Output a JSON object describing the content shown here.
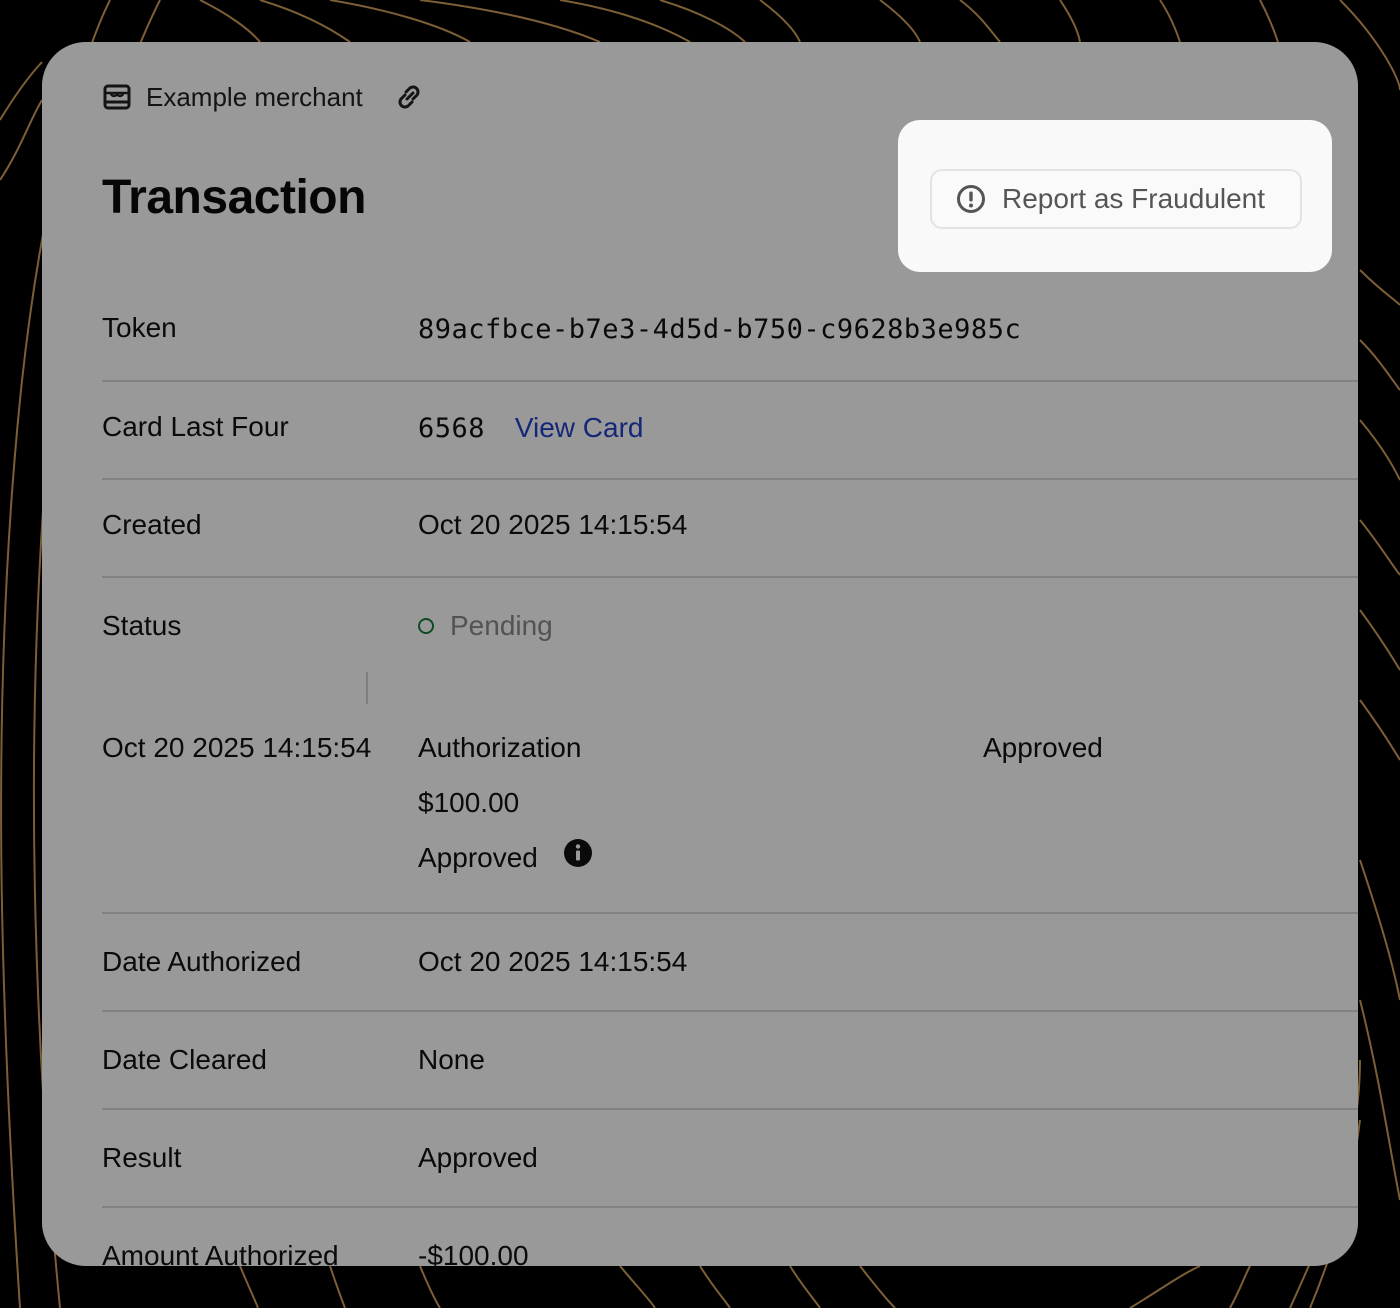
{
  "merchant": {
    "name": "Example merchant"
  },
  "page": {
    "title": "Transaction"
  },
  "actions": {
    "report_fraud_label": "Report as Fraudulent"
  },
  "fields": {
    "token": {
      "label": "Token",
      "value": "89acfbce-b7e3-4d5d-b750-c9628b3e985c"
    },
    "card_last_four": {
      "label": "Card Last Four",
      "value": "6568",
      "link_label": "View Card"
    },
    "created": {
      "label": "Created",
      "value": "Oct 20 2025 14:15:54"
    },
    "status": {
      "label": "Status",
      "value": "Pending"
    },
    "date_authorized": {
      "label": "Date Authorized",
      "value": "Oct 20 2025 14:15:54"
    },
    "date_cleared": {
      "label": "Date Cleared",
      "value": "None"
    },
    "result": {
      "label": "Result",
      "value": "Approved"
    },
    "amount_authorized": {
      "label": "Amount Authorized",
      "value": "-$100.00"
    }
  },
  "timeline": {
    "events": [
      {
        "timestamp": "Oct 20 2025 14:15:54",
        "type": "Authorization",
        "status": "Approved",
        "amount": "$100.00",
        "result": "Approved"
      }
    ]
  },
  "colors": {
    "link": "#2342c8",
    "status_pending": "#1b7a3a",
    "background": "#000000",
    "contour": "#8a6a3e"
  }
}
